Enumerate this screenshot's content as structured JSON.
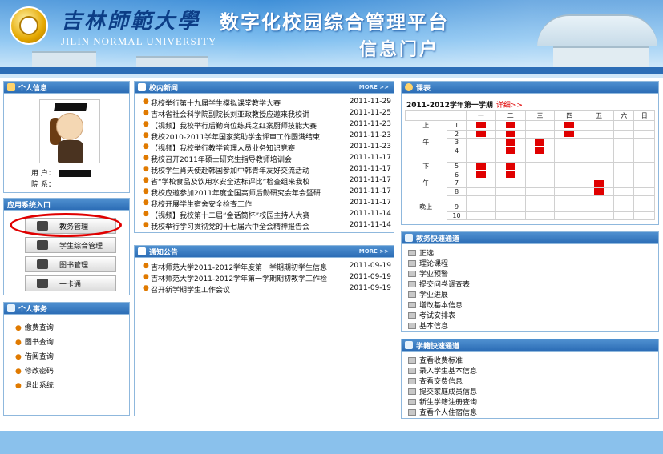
{
  "banner": {
    "univ_cn": "吉林師範大學",
    "univ_en": "JILIN NORMAL UNIVERSITY",
    "platform_title": "数字化校园综合管理平台",
    "portal_title": "信息门户"
  },
  "personal": {
    "header": "个人信息",
    "user_label": "用  户：",
    "dept_label": "院  系："
  },
  "apps": {
    "header": "应用系统入口",
    "items": [
      "教务管理",
      "学生综合管理",
      "图书管理",
      "一卡通"
    ]
  },
  "affairs": {
    "header": "个人事务",
    "items": [
      "缴费查询",
      "图书查询",
      "借阅查询",
      "修改密码",
      "退出系统"
    ]
  },
  "news": {
    "header": "校内新闻",
    "more": "MORE >>",
    "items": [
      {
        "title": "我校举行第十九届学生模拟课堂教学大赛",
        "date": "2011-11-29"
      },
      {
        "title": "吉林省社会科学院副院长刘亚政教授应邀来我校讲",
        "date": "2011-11-25"
      },
      {
        "title": "【视频】我校举行后勤岗位练兵之红案厨师技能大赛",
        "date": "2011-11-23"
      },
      {
        "title": "我校2010-2011学年国家奖助学金评审工作圆满结束",
        "date": "2011-11-23"
      },
      {
        "title": "【视频】我校举行教学管理人员业务知识竞赛",
        "date": "2011-11-23"
      },
      {
        "title": "我校召开2011年硕士研究生指导教师培训会",
        "date": "2011-11-17"
      },
      {
        "title": "我校学生肖天使赴韩国参加中韩青年友好交流活动",
        "date": "2011-11-17"
      },
      {
        "title": "省“学校食品及饮用水安全达标评比”检查组来我校",
        "date": "2011-11-17"
      },
      {
        "title": "我校应邀参加2011年度全国高师后勤研究会年会暨研",
        "date": "2011-11-17"
      },
      {
        "title": "我校开展学生宿舍安全检查工作",
        "date": "2011-11-17"
      },
      {
        "title": "【视频】我校第十二届“金话筒杯”校园主持人大赛",
        "date": "2011-11-14"
      },
      {
        "title": "我校举行学习贯彻党的十七届六中全会精神报告会",
        "date": "2011-11-14"
      }
    ]
  },
  "notice": {
    "header": "通知公告",
    "more": "MORE >>",
    "items": [
      {
        "title": "吉林师范大学2011-2012学年度第一学期期初学生信息",
        "date": "2011-09-19"
      },
      {
        "title": "吉林师范大学2011-2012学年第一学期期初教学工作检",
        "date": "2011-09-19"
      },
      {
        "title": "召开新学期学生工作会议",
        "date": "2011-09-19"
      }
    ]
  },
  "schedule": {
    "header": "课表",
    "semester": "2011-2012学年第一学期",
    "detail": "详细>>",
    "days": [
      "一",
      "二",
      "三",
      "四",
      "五",
      "六",
      "日"
    ],
    "period_groups": [
      {
        "label": "上",
        "rows": [
          1
        ]
      },
      {
        "label": "",
        "rows": [
          2
        ]
      },
      {
        "label": "午",
        "rows": [
          3
        ]
      },
      {
        "label": "",
        "rows": [
          4
        ]
      },
      {
        "label": "",
        "rows": []
      },
      {
        "label": "下",
        "rows": [
          5
        ]
      },
      {
        "label": "",
        "rows": [
          6
        ]
      },
      {
        "label": "午",
        "rows": [
          7
        ]
      },
      {
        "label": "",
        "rows": [
          8
        ]
      },
      {
        "label": "",
        "rows": []
      },
      {
        "label": "晚上",
        "rows": [
          9
        ]
      },
      {
        "label": "",
        "rows": [
          10
        ]
      }
    ],
    "occupied": [
      [
        1,
        1
      ],
      [
        1,
        2
      ],
      [
        1,
        4
      ],
      [
        2,
        1
      ],
      [
        2,
        2
      ],
      [
        2,
        4
      ],
      [
        3,
        2
      ],
      [
        3,
        3
      ],
      [
        4,
        2
      ],
      [
        4,
        3
      ],
      [
        5,
        1
      ],
      [
        5,
        2
      ],
      [
        6,
        1
      ],
      [
        6,
        2
      ],
      [
        7,
        5
      ],
      [
        8,
        5
      ]
    ]
  },
  "jw": {
    "header": "教务快速通道",
    "items": [
      "正选",
      "理论课程",
      "学业预警",
      "提交问卷调查表",
      "学业进展",
      "增改基本信息",
      "考试安排表",
      "基本信息"
    ]
  },
  "xj": {
    "header": "学籍快速通道",
    "items": [
      "查看收费标准",
      "录入学生基本信息",
      "查看交费信息",
      "提交家庭成员信息",
      "新生学籍注册查询",
      "查看个人住宿信息"
    ]
  },
  "colors": {
    "header_blue": "#2c6db6",
    "schedule_red": "#e00000",
    "highlight_circle": "#e00000"
  }
}
